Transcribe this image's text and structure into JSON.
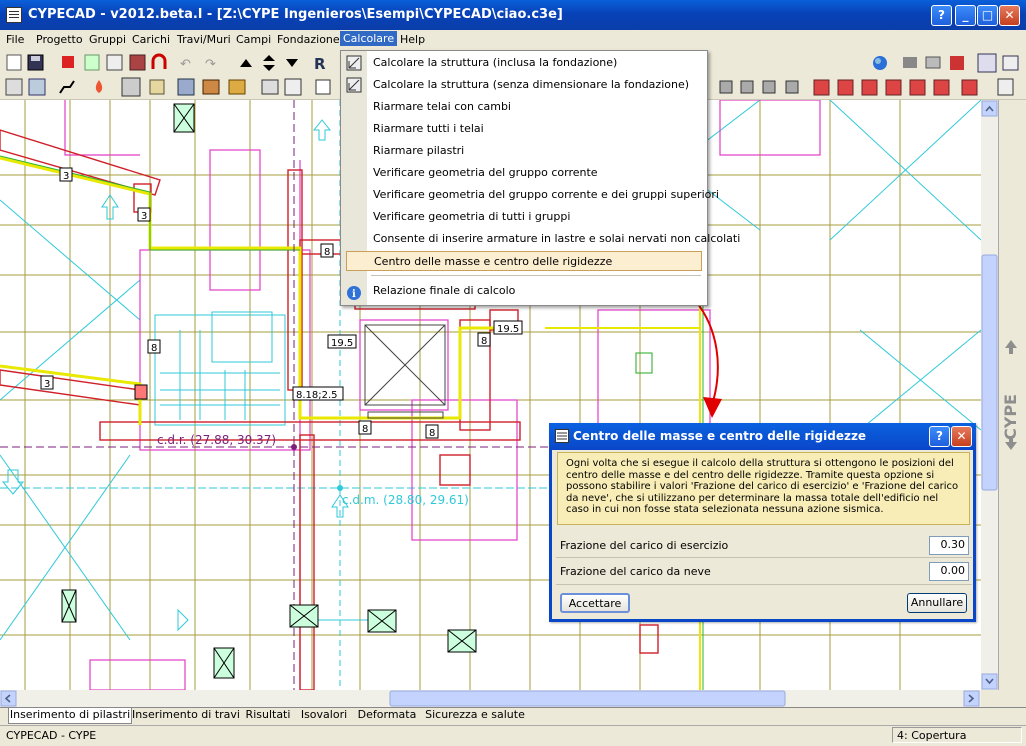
{
  "window": {
    "title": "CYPECAD - v2012.beta.l - [Z:\\CYPE Ingenieros\\Esempi\\CYPECAD\\ciao.c3e]"
  },
  "menubar": [
    "File",
    "Progetto",
    "Gruppi",
    "Carichi",
    "Travi/Muri",
    "Campi",
    "Fondazione",
    "Calcolare",
    "Help"
  ],
  "dropdown": {
    "items": [
      "Calcolare la struttura (inclusa la fondazione)",
      "Calcolare la struttura (senza dimensionare la fondazione)",
      "Riarmare telai con cambi",
      "Riarmare tutti i telai",
      "Riarmare pilastri",
      "Verificare geometria del gruppo corrente",
      "Verificare geometria del gruppo corrente e dei gruppi superiori",
      "Verificare geometria di tutti i gruppi",
      "Consente di inserire armature in lastre e solai nervati non calcolati",
      "Centro delle masse e centro delle rigidezze",
      "Relazione finale di calcolo"
    ]
  },
  "canvas": {
    "labels": [
      "3",
      "3",
      "3",
      "8",
      "8",
      "8",
      "8",
      "8",
      "19.5",
      "19.5",
      "8.18;2.5"
    ],
    "cdr": "c.d.r. (27.88, 30.37)",
    "cdm": "c.d.m. (28.80, 29.61)"
  },
  "side_logo": "CYPE",
  "dialog": {
    "title": "Centro delle masse e centro delle rigidezze",
    "info": "Ogni volta che si esegue il calcolo della struttura si ottengono le posizioni del centro delle masse e del centro delle rigidezze. Tramite questa opzione si possono stabilire i valori 'Frazione del carico di esercizio' e 'Frazione del carico da neve', che si utilizzano per determinare la massa totale dell'edificio nel caso in cui non fosse stata selezionata nessuna azione sismica.",
    "fields": [
      {
        "label": "Frazione del carico di esercizio",
        "value": "0.30"
      },
      {
        "label": "Frazione del carico da neve",
        "value": "0.00"
      }
    ],
    "ok": "Accettare",
    "cancel": "Annullare"
  },
  "tabs": [
    "Inserimento di pilastri",
    "Inserimento di travi",
    "Risultati",
    "Isovalori",
    "Deformata",
    "Sicurezza e salute"
  ],
  "status": {
    "left": "CYPECAD - CYPE",
    "right": "4: Copertura"
  },
  "colors": {
    "accent": "#0A46C8",
    "highlight": "#FCEED0",
    "arrow": "#E00000"
  }
}
